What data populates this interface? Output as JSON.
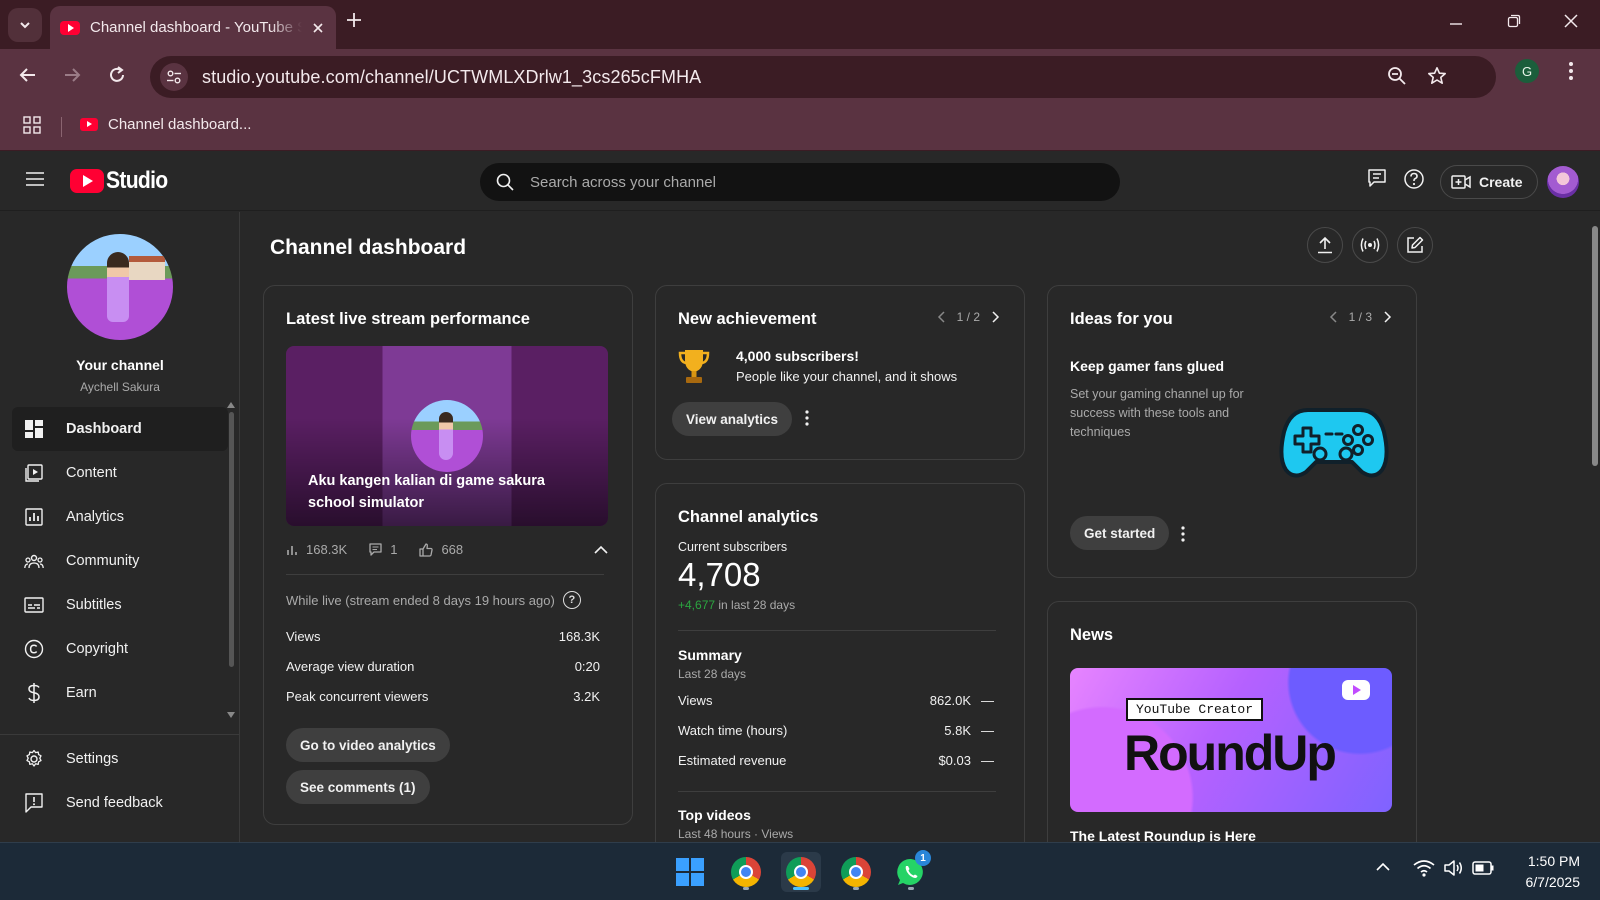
{
  "browser": {
    "tab_title": "Channel dashboard - YouTube Studio",
    "url": "studio.youtube.com/channel/UCTWMLXDrlw1_3cs265cFMHA",
    "profile_initial": "G",
    "bookmark_label": "Channel dashboard..."
  },
  "header": {
    "logo_text": "Studio",
    "search_placeholder": "Search across your channel",
    "create_label": "Create"
  },
  "sidebar": {
    "channel_name": "Your channel",
    "channel_handle": "Aychell Sakura",
    "items": [
      {
        "label": "Dashboard",
        "icon": "dashboard-icon",
        "active": true
      },
      {
        "label": "Content",
        "icon": "content-icon"
      },
      {
        "label": "Analytics",
        "icon": "analytics-icon"
      },
      {
        "label": "Community",
        "icon": "community-icon"
      },
      {
        "label": "Subtitles",
        "icon": "subtitles-icon"
      },
      {
        "label": "Copyright",
        "icon": "copyright-icon"
      },
      {
        "label": "Earn",
        "icon": "earn-icon"
      }
    ],
    "footer_items": [
      {
        "label": "Settings",
        "icon": "gear-icon"
      },
      {
        "label": "Send feedback",
        "icon": "feedback-icon"
      }
    ]
  },
  "page": {
    "title": "Channel dashboard"
  },
  "live_card": {
    "title": "Latest live stream performance",
    "video_title": "Aku kangen kalian di game sakura school simulator",
    "views_short": "168.3K",
    "comments": "1",
    "likes": "668",
    "while_live": "While live (stream ended 8 days 19 hours ago)",
    "help_glyph": "?",
    "metrics": [
      {
        "label": "Views",
        "value": "168.3K"
      },
      {
        "label": "Average view duration",
        "value": "0:20"
      },
      {
        "label": "Peak concurrent viewers",
        "value": "3.2K"
      }
    ],
    "btn_analytics": "Go to video analytics",
    "btn_comments": "See comments (1)"
  },
  "achievement_card": {
    "title": "New achievement",
    "pager": "1 / 2",
    "headline": "4,000 subscribers!",
    "subline": "People like your channel, and it shows",
    "btn": "View analytics"
  },
  "analytics_card": {
    "title": "Channel analytics",
    "subs_label": "Current subscribers",
    "subs_value": "4,708",
    "delta_value": "+4,677",
    "delta_suffix": " in last 28 days",
    "summary_title": "Summary",
    "summary_period": "Last 28 days",
    "summary": [
      {
        "label": "Views",
        "value": "862.0K",
        "trend": "—"
      },
      {
        "label": "Watch time (hours)",
        "value": "5.8K",
        "trend": "—"
      },
      {
        "label": "Estimated revenue",
        "value": "$0.03",
        "trend": "—"
      }
    ],
    "top_videos_title": "Top videos",
    "top_videos_period": "Last 48 hours · Views"
  },
  "ideas_card": {
    "title": "Ideas for you",
    "pager": "1 / 3",
    "headline": "Keep gamer fans glued",
    "description": "Set your gaming channel up for success with these tools and techniques",
    "btn": "Get started"
  },
  "news_card": {
    "title": "News",
    "banner_tag": "YouTube Creator",
    "banner_title": "RoundUp",
    "caption": "The Latest Roundup is Here"
  },
  "taskbar": {
    "whatsapp_badge": "1",
    "time": "1:50 PM",
    "date": "6/7/2025"
  },
  "colors": {
    "accent_red": "#ff0033",
    "positive_green": "#2ba640",
    "gamepad_cyan": "#1ec8f0"
  }
}
